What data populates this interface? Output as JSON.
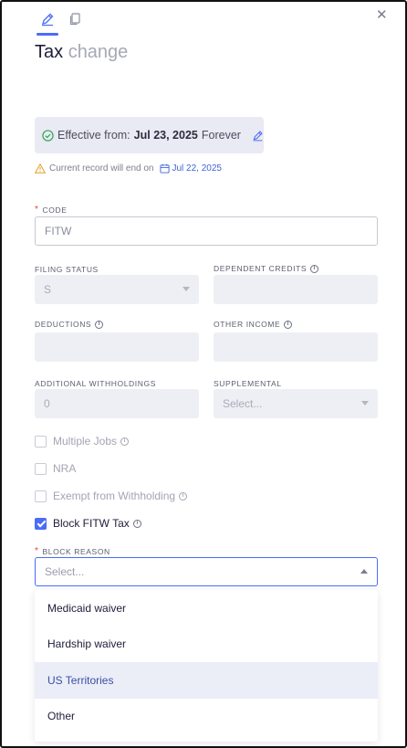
{
  "tabs": [
    {
      "icon": "pencil-icon",
      "active": true
    },
    {
      "icon": "copy-icon",
      "active": false
    }
  ],
  "title": {
    "main": "Tax",
    "accent": "change"
  },
  "effective": {
    "prefix": "Effective from:",
    "date": "Jul 23, 2025",
    "suffix": "Forever"
  },
  "warning": {
    "text": "Current record will end on",
    "date": "Jul 22, 2025"
  },
  "fields": {
    "code": {
      "label": "CODE",
      "value": "FITW",
      "required": true
    },
    "filing_status": {
      "label": "FILING STATUS",
      "value": "S"
    },
    "dependent_credits": {
      "label": "DEPENDENT CREDITS",
      "value": ""
    },
    "deductions": {
      "label": "DEDUCTIONS",
      "value": ""
    },
    "other_income": {
      "label": "OTHER INCOME",
      "value": ""
    },
    "additional_withholdings": {
      "label": "ADDITIONAL WITHHOLDINGS",
      "value": "0"
    },
    "supplemental": {
      "label": "SUPPLEMENTAL",
      "placeholder": "Select..."
    },
    "block_reason": {
      "label": "BLOCK REASON",
      "placeholder": "Select...",
      "required": true
    }
  },
  "checkboxes": [
    {
      "label": "Multiple Jobs",
      "checked": false,
      "info": true
    },
    {
      "label": "NRA",
      "checked": false,
      "info": false
    },
    {
      "label": "Exempt from Withholding",
      "checked": false,
      "info": true
    },
    {
      "label": "Block FITW Tax",
      "checked": true,
      "info": true
    }
  ],
  "block_reason_options": [
    "Medicaid waiver",
    "Hardship waiver",
    "US Territories",
    "Other"
  ],
  "highlighted_option": "US Territories",
  "colors": {
    "accent": "#4a6cf7",
    "required": "#e0443a",
    "success": "#2fa84f",
    "warning": "#e0a12a"
  }
}
